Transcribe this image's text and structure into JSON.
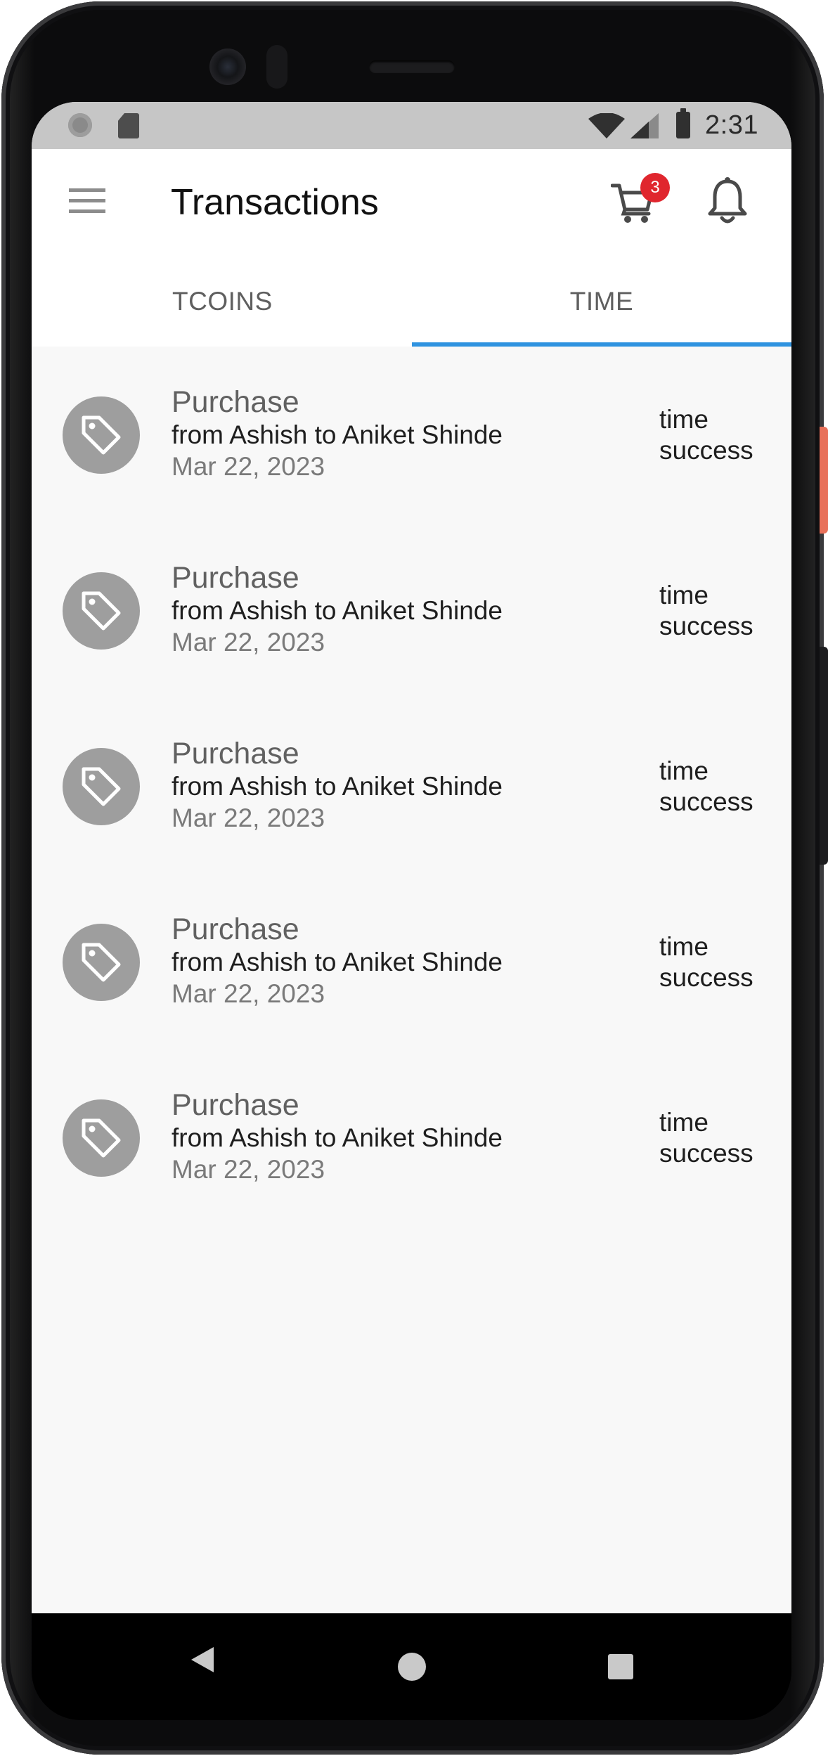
{
  "status_bar": {
    "time": "2:31"
  },
  "app_bar": {
    "title": "Transactions",
    "cart_badge_count": "3"
  },
  "tabs": [
    {
      "label": "TCOINS",
      "selected": false
    },
    {
      "label": "TIME",
      "selected": true
    }
  ],
  "transactions": [
    {
      "title": "Purchase",
      "description": "from Ashish to Aniket Shinde",
      "date": "Mar 22, 2023",
      "type": "time",
      "status": "success"
    },
    {
      "title": "Purchase",
      "description": "from Ashish to Aniket Shinde",
      "date": "Mar 22, 2023",
      "type": "time",
      "status": "success"
    },
    {
      "title": "Purchase",
      "description": "from Ashish to Aniket Shinde",
      "date": "Mar 22, 2023",
      "type": "time",
      "status": "success"
    },
    {
      "title": "Purchase",
      "description": "from Ashish to Aniket Shinde",
      "date": "Mar 22, 2023",
      "type": "time",
      "status": "success"
    },
    {
      "title": "Purchase",
      "description": "from Ashish to Aniket Shinde",
      "date": "Mar 22, 2023",
      "type": "time",
      "status": "success"
    }
  ],
  "icons": {
    "menu": "hamburger-menu-icon",
    "cart": "shopping-cart-icon",
    "notifications": "bell-icon",
    "transaction": "price-tag-icon",
    "nav_back": "back-triangle-icon",
    "nav_home": "home-circle-icon",
    "nav_recents": "recents-square-icon"
  },
  "colors": {
    "tab_indicator": "#2f93e0",
    "badge": "#e0262e",
    "avatar": "#9e9e9e",
    "list_background": "#f8f8f8"
  }
}
